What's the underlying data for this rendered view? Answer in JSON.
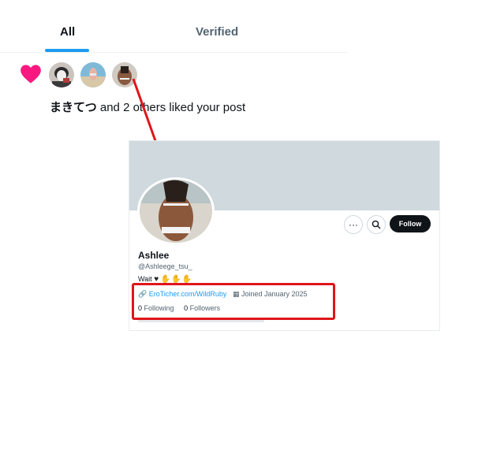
{
  "tabs": {
    "all": "All",
    "verified": "Verified"
  },
  "notification": {
    "actor": "まきてつ",
    "rest": " and 2 others liked your post"
  },
  "profile": {
    "name": "Ashlee",
    "handle": "@Ashleege_tsu_",
    "bio_text": "Wait",
    "bio_heart": "♥",
    "bio_emojis": "✋✋✋",
    "link": "EroTicher.com/WildRuby",
    "joined": "Joined January 2025",
    "following_count": "0",
    "following_label": " Following",
    "followers_count": "0",
    "followers_label": " Followers",
    "follow_label": "Follow",
    "more_label": "···",
    "search_icon": "search-icon"
  },
  "colors": {
    "heart": "#f91880",
    "accent": "#1d9bf0",
    "highlight": "#e0151a"
  }
}
